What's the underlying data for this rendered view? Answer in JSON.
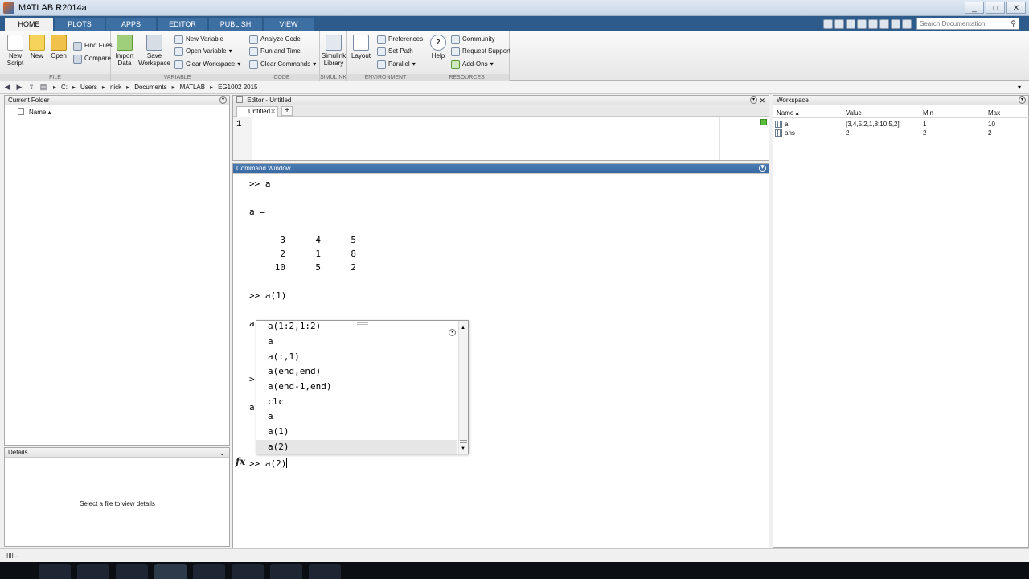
{
  "window": {
    "title": "MATLAB R2014a",
    "min": "_",
    "max": "□",
    "close": "✕"
  },
  "tabs": [
    "HOME",
    "PLOTS",
    "APPS",
    "EDITOR",
    "PUBLISH",
    "VIEW"
  ],
  "search": {
    "placeholder": "Search Documentation",
    "icon": "search-icon"
  },
  "ribbon": {
    "file": {
      "label": "FILE",
      "new_script": "New Script",
      "new": "New",
      "open": "Open",
      "find_files": "Find Files",
      "compare": "Compare"
    },
    "variable": {
      "label": "VARIABLE",
      "import_data": "Import Data",
      "save_workspace": "Save Workspace",
      "new_variable": "New Variable",
      "open_variable": "Open Variable",
      "clear_workspace": "Clear Workspace"
    },
    "code": {
      "label": "CODE",
      "analyze_code": "Analyze Code",
      "run_and_time": "Run and Time",
      "clear_commands": "Clear Commands"
    },
    "simulink": {
      "label": "SIMULINK",
      "library": "Simulink Library"
    },
    "environment": {
      "label": "ENVIRONMENT",
      "layout": "Layout",
      "preferences": "Preferences",
      "set_path": "Set Path",
      "parallel": "Parallel"
    },
    "resources": {
      "label": "RESOURCES",
      "help": "Help",
      "community": "Community",
      "request_support": "Request Support",
      "add_ons": "Add-Ons"
    }
  },
  "path": [
    "C:",
    "Users",
    "nick",
    "Documents",
    "MATLAB",
    "EG1002 2015"
  ],
  "current_folder": {
    "title": "Current Folder",
    "col_name": "Name ▴"
  },
  "details": {
    "title": "Details",
    "message": "Select a file to view details"
  },
  "editor": {
    "title": "Editor - Untitled",
    "tab": "Untitled",
    "line": "1"
  },
  "command_window": {
    "title": "Command Window",
    "lines": [
      ">> a",
      "a =",
      ">> a(1)"
    ],
    "matrix": [
      [
        "3",
        "4",
        "5"
      ],
      [
        "2",
        "1",
        "8"
      ],
      [
        "10",
        "5",
        "2"
      ]
    ],
    "occluded": [
      "a",
      ">",
      "a"
    ],
    "prompt": ">> a(2)",
    "fx": "fx"
  },
  "history_popup": {
    "items": [
      "a(1:2,1:2)",
      "a",
      "a(:,1)",
      "a(end,end)",
      "a(end-1,end)",
      "clc",
      "a",
      "a(1)",
      "a(2)"
    ],
    "selected": 8
  },
  "workspace": {
    "title": "Workspace",
    "columns": [
      "Name ▴",
      "Value",
      "Min",
      "Max"
    ],
    "rows": [
      {
        "name": "a",
        "value": "[3,4,5;2,1,8;10,5,2]",
        "min": "1",
        "max": "10"
      },
      {
        "name": "ans",
        "value": "2",
        "min": "2",
        "max": "2"
      }
    ]
  },
  "status": "IIII -"
}
